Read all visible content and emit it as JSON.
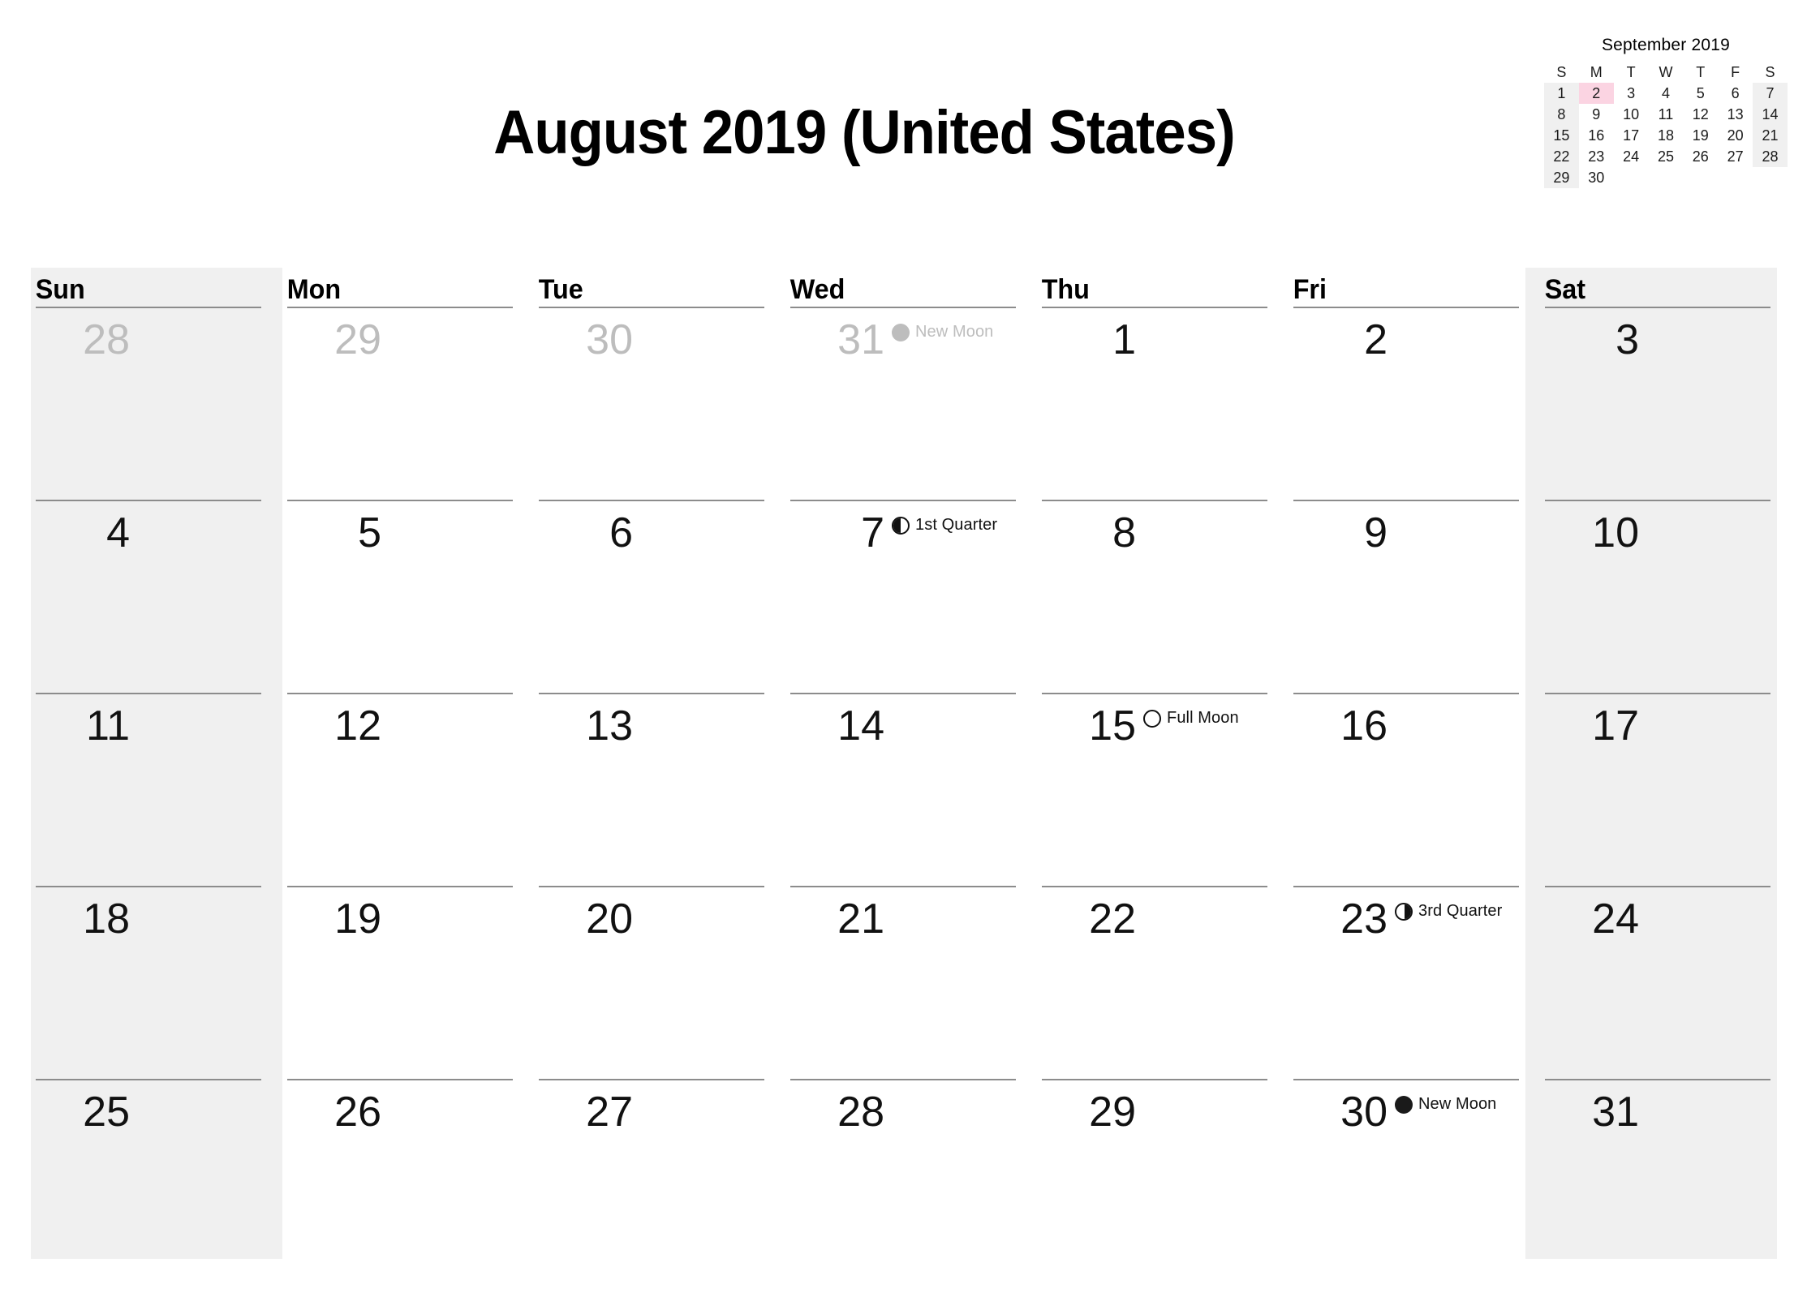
{
  "title": "August 2019 (United States)",
  "mini_month": {
    "title": "September 2019",
    "dow_initials": [
      "S",
      "M",
      "T",
      "W",
      "T",
      "F",
      "S"
    ],
    "weeks": [
      [
        "1",
        "2",
        "3",
        "4",
        "5",
        "6",
        "7"
      ],
      [
        "8",
        "9",
        "10",
        "11",
        "12",
        "13",
        "14"
      ],
      [
        "15",
        "16",
        "17",
        "18",
        "19",
        "20",
        "21"
      ],
      [
        "22",
        "23",
        "24",
        "25",
        "26",
        "27",
        "28"
      ],
      [
        "29",
        "30",
        "",
        "",
        "",
        "",
        ""
      ]
    ],
    "highlighted": [
      "2"
    ],
    "highlight_color": "#fbd4e2",
    "weekend_color": "#f0f0f0"
  },
  "calendar": {
    "weekday_headers": [
      "Sun",
      "Mon",
      "Tue",
      "Wed",
      "Thu",
      "Fri",
      "Sat"
    ],
    "weekend_band_color": "#f0f0f0",
    "weeks": [
      [
        {
          "day": "28",
          "in_month": false
        },
        {
          "day": "29",
          "in_month": false
        },
        {
          "day": "30",
          "in_month": false
        },
        {
          "day": "31",
          "in_month": false,
          "moon": {
            "phase": "new",
            "label": "New Moon",
            "dim": true
          }
        },
        {
          "day": "1",
          "in_month": true
        },
        {
          "day": "2",
          "in_month": true
        },
        {
          "day": "3",
          "in_month": true
        }
      ],
      [
        {
          "day": "4",
          "in_month": true
        },
        {
          "day": "5",
          "in_month": true
        },
        {
          "day": "6",
          "in_month": true
        },
        {
          "day": "7",
          "in_month": true,
          "moon": {
            "phase": "first",
            "label": "1st Quarter",
            "dim": false
          }
        },
        {
          "day": "8",
          "in_month": true
        },
        {
          "day": "9",
          "in_month": true
        },
        {
          "day": "10",
          "in_month": true
        }
      ],
      [
        {
          "day": "11",
          "in_month": true
        },
        {
          "day": "12",
          "in_month": true
        },
        {
          "day": "13",
          "in_month": true
        },
        {
          "day": "14",
          "in_month": true
        },
        {
          "day": "15",
          "in_month": true,
          "moon": {
            "phase": "full",
            "label": "Full Moon",
            "dim": false
          }
        },
        {
          "day": "16",
          "in_month": true
        },
        {
          "day": "17",
          "in_month": true
        }
      ],
      [
        {
          "day": "18",
          "in_month": true
        },
        {
          "day": "19",
          "in_month": true
        },
        {
          "day": "20",
          "in_month": true
        },
        {
          "day": "21",
          "in_month": true
        },
        {
          "day": "22",
          "in_month": true
        },
        {
          "day": "23",
          "in_month": true,
          "moon": {
            "phase": "third",
            "label": "3rd Quarter",
            "dim": false
          }
        },
        {
          "day": "24",
          "in_month": true
        }
      ],
      [
        {
          "day": "25",
          "in_month": true
        },
        {
          "day": "26",
          "in_month": true
        },
        {
          "day": "27",
          "in_month": true
        },
        {
          "day": "28",
          "in_month": true
        },
        {
          "day": "29",
          "in_month": true
        },
        {
          "day": "30",
          "in_month": true,
          "moon": {
            "phase": "new",
            "label": "New Moon",
            "dim": false
          }
        },
        {
          "day": "31",
          "in_month": true
        }
      ]
    ]
  }
}
